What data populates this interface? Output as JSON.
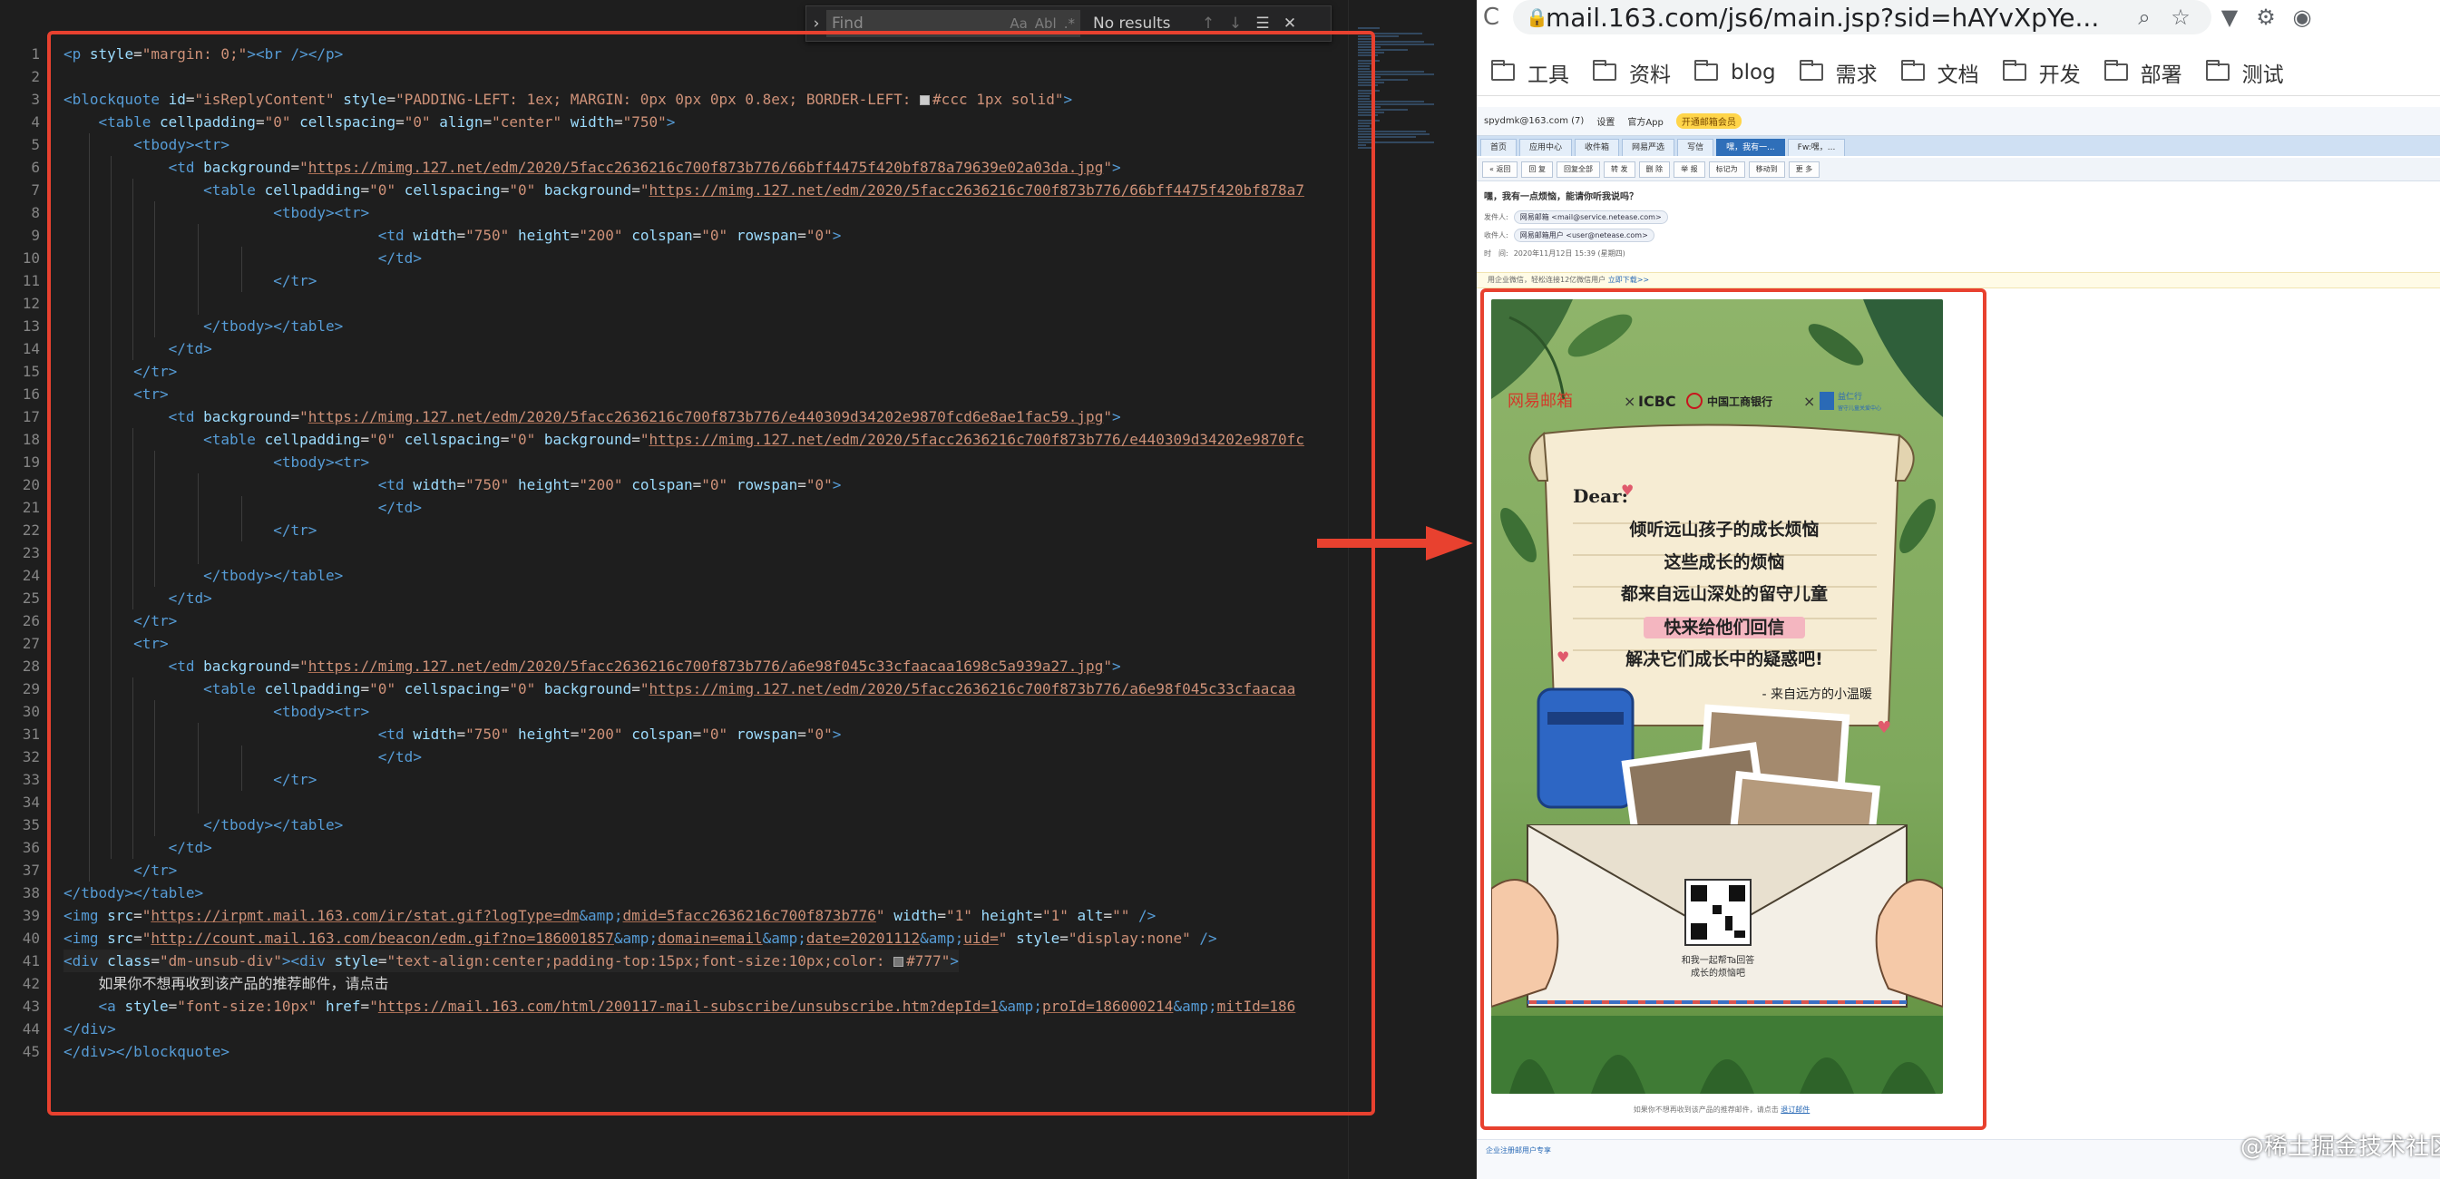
{
  "colors": {
    "accent_red": "#e8412f",
    "editor_bg": "#1e1e1e",
    "tag": "#569cd6",
    "attr": "#9cdcfe",
    "value": "#ce9178"
  },
  "find": {
    "placeholder": "Find",
    "opt_case": "Aa",
    "opt_word": "Abl",
    "opt_regex": ".*",
    "result": "No results",
    "icons": [
      "chevron-right-icon",
      "arrow-up-icon",
      "arrow-down-icon",
      "selection-icon",
      "close-icon"
    ]
  },
  "code": {
    "lines": [
      [
        [
          "tg",
          "<p "
        ],
        [
          "at",
          "style"
        ],
        [
          "eq",
          "="
        ],
        [
          "av",
          "\"margin: 0;\""
        ],
        [
          "tg",
          "><br /></p>"
        ]
      ],
      [],
      [
        [
          "tg",
          "<blockquote "
        ],
        [
          "at",
          "id"
        ],
        [
          "eq",
          "="
        ],
        [
          "av",
          "\"isReplyContent\""
        ],
        [
          "eq",
          " "
        ],
        [
          "at",
          "style"
        ],
        [
          "eq",
          "="
        ],
        [
          "av",
          "\"PADDING-LEFT: 1ex; MARGIN: 0px 0px 0px 0.8ex; BORDER-LEFT: "
        ],
        [
          "sw",
          "#ccc"
        ],
        [
          "av",
          "#ccc 1px solid\""
        ],
        [
          "tg",
          ">"
        ]
      ],
      [
        [
          "ws",
          "    "
        ],
        [
          "tg",
          "<table "
        ],
        [
          "at",
          "cellpadding"
        ],
        [
          "eq",
          "="
        ],
        [
          "av",
          "\"0\""
        ],
        [
          "eq",
          " "
        ],
        [
          "at",
          "cellspacing"
        ],
        [
          "eq",
          "="
        ],
        [
          "av",
          "\"0\""
        ],
        [
          "eq",
          " "
        ],
        [
          "at",
          "align"
        ],
        [
          "eq",
          "="
        ],
        [
          "av",
          "\"center\""
        ],
        [
          "eq",
          " "
        ],
        [
          "at",
          "width"
        ],
        [
          "eq",
          "="
        ],
        [
          "av",
          "\"750\""
        ],
        [
          "tg",
          ">"
        ]
      ],
      [
        [
          "ws",
          "        "
        ],
        [
          "tg",
          "<tbody><tr>"
        ]
      ],
      [
        [
          "ws",
          "            "
        ],
        [
          "tg",
          "<td "
        ],
        [
          "at",
          "background"
        ],
        [
          "eq",
          "="
        ],
        [
          "av",
          "\""
        ],
        [
          "ul",
          "https://mimg.127.net/edm/2020/5facc2636216c700f873b776/66bff4475f420bf878a79639e02a03da.jpg"
        ],
        [
          "av",
          "\""
        ],
        [
          "tg",
          ">"
        ]
      ],
      [
        [
          "ws",
          "                "
        ],
        [
          "tg",
          "<table "
        ],
        [
          "at",
          "cellpadding"
        ],
        [
          "eq",
          "="
        ],
        [
          "av",
          "\"0\""
        ],
        [
          "eq",
          " "
        ],
        [
          "at",
          "cellspacing"
        ],
        [
          "eq",
          "="
        ],
        [
          "av",
          "\"0\""
        ],
        [
          "eq",
          " "
        ],
        [
          "at",
          "background"
        ],
        [
          "eq",
          "="
        ],
        [
          "av",
          "\""
        ],
        [
          "ul",
          "https://mimg.127.net/edm/2020/5facc2636216c700f873b776/66bff4475f420bf878a7"
        ]
      ],
      [
        [
          "ws",
          "                        "
        ],
        [
          "tg",
          "<tbody><tr>"
        ]
      ],
      [
        [
          "ws",
          "                                    "
        ],
        [
          "tg",
          "<td "
        ],
        [
          "at",
          "width"
        ],
        [
          "eq",
          "="
        ],
        [
          "av",
          "\"750\""
        ],
        [
          "eq",
          " "
        ],
        [
          "at",
          "height"
        ],
        [
          "eq",
          "="
        ],
        [
          "av",
          "\"200\""
        ],
        [
          "eq",
          " "
        ],
        [
          "at",
          "colspan"
        ],
        [
          "eq",
          "="
        ],
        [
          "av",
          "\"0\""
        ],
        [
          "eq",
          " "
        ],
        [
          "at",
          "rowspan"
        ],
        [
          "eq",
          "="
        ],
        [
          "av",
          "\"0\""
        ],
        [
          "tg",
          ">"
        ]
      ],
      [
        [
          "ws",
          "                                    "
        ],
        [
          "tg",
          "</td>"
        ]
      ],
      [
        [
          "ws",
          "                        "
        ],
        [
          "tg",
          "</tr>"
        ]
      ],
      [],
      [
        [
          "ws",
          "                "
        ],
        [
          "tg",
          "</tbody></table>"
        ]
      ],
      [
        [
          "ws",
          "            "
        ],
        [
          "tg",
          "</td>"
        ]
      ],
      [
        [
          "ws",
          "        "
        ],
        [
          "tg",
          "</tr>"
        ]
      ],
      [
        [
          "ws",
          "        "
        ],
        [
          "tg",
          "<tr>"
        ]
      ],
      [
        [
          "ws",
          "            "
        ],
        [
          "tg",
          "<td "
        ],
        [
          "at",
          "background"
        ],
        [
          "eq",
          "="
        ],
        [
          "av",
          "\""
        ],
        [
          "ul",
          "https://mimg.127.net/edm/2020/5facc2636216c700f873b776/e440309d34202e9870fcd6e8ae1fac59.jpg"
        ],
        [
          "av",
          "\""
        ],
        [
          "tg",
          ">"
        ]
      ],
      [
        [
          "ws",
          "                "
        ],
        [
          "tg",
          "<table "
        ],
        [
          "at",
          "cellpadding"
        ],
        [
          "eq",
          "="
        ],
        [
          "av",
          "\"0\""
        ],
        [
          "eq",
          " "
        ],
        [
          "at",
          "cellspacing"
        ],
        [
          "eq",
          "="
        ],
        [
          "av",
          "\"0\""
        ],
        [
          "eq",
          " "
        ],
        [
          "at",
          "background"
        ],
        [
          "eq",
          "="
        ],
        [
          "av",
          "\""
        ],
        [
          "ul",
          "https://mimg.127.net/edm/2020/5facc2636216c700f873b776/e440309d34202e9870fc"
        ]
      ],
      [
        [
          "ws",
          "                        "
        ],
        [
          "tg",
          "<tbody><tr>"
        ]
      ],
      [
        [
          "ws",
          "                                    "
        ],
        [
          "tg",
          "<td "
        ],
        [
          "at",
          "width"
        ],
        [
          "eq",
          "="
        ],
        [
          "av",
          "\"750\""
        ],
        [
          "eq",
          " "
        ],
        [
          "at",
          "height"
        ],
        [
          "eq",
          "="
        ],
        [
          "av",
          "\"200\""
        ],
        [
          "eq",
          " "
        ],
        [
          "at",
          "colspan"
        ],
        [
          "eq",
          "="
        ],
        [
          "av",
          "\"0\""
        ],
        [
          "eq",
          " "
        ],
        [
          "at",
          "rowspan"
        ],
        [
          "eq",
          "="
        ],
        [
          "av",
          "\"0\""
        ],
        [
          "tg",
          ">"
        ]
      ],
      [
        [
          "ws",
          "                                    "
        ],
        [
          "tg",
          "</td>"
        ]
      ],
      [
        [
          "ws",
          "                        "
        ],
        [
          "tg",
          "</tr>"
        ]
      ],
      [],
      [
        [
          "ws",
          "                "
        ],
        [
          "tg",
          "</tbody></table>"
        ]
      ],
      [
        [
          "ws",
          "            "
        ],
        [
          "tg",
          "</td>"
        ]
      ],
      [
        [
          "ws",
          "        "
        ],
        [
          "tg",
          "</tr>"
        ]
      ],
      [
        [
          "ws",
          "        "
        ],
        [
          "tg",
          "<tr>"
        ]
      ],
      [
        [
          "ws",
          "            "
        ],
        [
          "tg",
          "<td "
        ],
        [
          "at",
          "background"
        ],
        [
          "eq",
          "="
        ],
        [
          "av",
          "\""
        ],
        [
          "ul",
          "https://mimg.127.net/edm/2020/5facc2636216c700f873b776/a6e98f045c33cfaacaa1698c5a939a27.jpg"
        ],
        [
          "av",
          "\""
        ],
        [
          "tg",
          ">"
        ]
      ],
      [
        [
          "ws",
          "                "
        ],
        [
          "tg",
          "<table "
        ],
        [
          "at",
          "cellpadding"
        ],
        [
          "eq",
          "="
        ],
        [
          "av",
          "\"0\""
        ],
        [
          "eq",
          " "
        ],
        [
          "at",
          "cellspacing"
        ],
        [
          "eq",
          "="
        ],
        [
          "av",
          "\"0\""
        ],
        [
          "eq",
          " "
        ],
        [
          "at",
          "background"
        ],
        [
          "eq",
          "="
        ],
        [
          "av",
          "\""
        ],
        [
          "ul",
          "https://mimg.127.net/edm/2020/5facc2636216c700f873b776/a6e98f045c33cfaacaa"
        ]
      ],
      [
        [
          "ws",
          "                        "
        ],
        [
          "tg",
          "<tbody><tr>"
        ]
      ],
      [
        [
          "ws",
          "                                    "
        ],
        [
          "tg",
          "<td "
        ],
        [
          "at",
          "width"
        ],
        [
          "eq",
          "="
        ],
        [
          "av",
          "\"750\""
        ],
        [
          "eq",
          " "
        ],
        [
          "at",
          "height"
        ],
        [
          "eq",
          "="
        ],
        [
          "av",
          "\"200\""
        ],
        [
          "eq",
          " "
        ],
        [
          "at",
          "colspan"
        ],
        [
          "eq",
          "="
        ],
        [
          "av",
          "\"0\""
        ],
        [
          "eq",
          " "
        ],
        [
          "at",
          "rowspan"
        ],
        [
          "eq",
          "="
        ],
        [
          "av",
          "\"0\""
        ],
        [
          "tg",
          ">"
        ]
      ],
      [
        [
          "ws",
          "                                    "
        ],
        [
          "tg",
          "</td>"
        ]
      ],
      [
        [
          "ws",
          "                        "
        ],
        [
          "tg",
          "</tr>"
        ]
      ],
      [],
      [
        [
          "ws",
          "                "
        ],
        [
          "tg",
          "</tbody></table>"
        ]
      ],
      [
        [
          "ws",
          "            "
        ],
        [
          "tg",
          "</td>"
        ]
      ],
      [
        [
          "ws",
          "        "
        ],
        [
          "tg",
          "</tr>"
        ]
      ],
      [
        [
          "tg",
          "</tbody></table>"
        ]
      ],
      [
        [
          "tg",
          "<img "
        ],
        [
          "at",
          "src"
        ],
        [
          "eq",
          "="
        ],
        [
          "av",
          "\""
        ],
        [
          "ul",
          "https://irpmt.mail.163.com/ir/stat.gif?logType=dm"
        ],
        [
          "ent",
          "&amp;"
        ],
        [
          "ul",
          "dmid=5facc2636216c700f873b776"
        ],
        [
          "av",
          "\""
        ],
        [
          "eq",
          " "
        ],
        [
          "at",
          "width"
        ],
        [
          "eq",
          "="
        ],
        [
          "av",
          "\"1\""
        ],
        [
          "eq",
          " "
        ],
        [
          "at",
          "height"
        ],
        [
          "eq",
          "="
        ],
        [
          "av",
          "\"1\""
        ],
        [
          "eq",
          " "
        ],
        [
          "at",
          "alt"
        ],
        [
          "eq",
          "="
        ],
        [
          "av",
          "\"\""
        ],
        [
          "tg",
          " />"
        ]
      ],
      [
        [
          "tg",
          "<img "
        ],
        [
          "at",
          "src"
        ],
        [
          "eq",
          "="
        ],
        [
          "av",
          "\""
        ],
        [
          "ul",
          "http://count.mail.163.com/beacon/edm.gif?no=186001857"
        ],
        [
          "ent",
          "&amp;"
        ],
        [
          "ul",
          "domain=email"
        ],
        [
          "ent",
          "&amp;"
        ],
        [
          "ul",
          "date=20201112"
        ],
        [
          "ent",
          "&amp;"
        ],
        [
          "ul",
          "uid="
        ],
        [
          "av",
          "\""
        ],
        [
          "eq",
          " "
        ],
        [
          "at",
          "style"
        ],
        [
          "eq",
          "="
        ],
        [
          "av",
          "\"display:none\""
        ],
        [
          "tg",
          " />"
        ]
      ],
      [
        [
          "tg",
          "<div "
        ],
        [
          "at",
          "class"
        ],
        [
          "eq",
          "="
        ],
        [
          "av",
          "\"dm-unsub-div\""
        ],
        [
          "tg",
          ">"
        ],
        [
          "tg",
          "<div "
        ],
        [
          "at",
          "style"
        ],
        [
          "eq",
          "="
        ],
        [
          "av",
          "\"text-align:center;padding-top:15px;font-size:10px;color: "
        ],
        [
          "sw",
          "#777"
        ],
        [
          "av",
          "#777\""
        ],
        [
          "tg",
          ">"
        ]
      ],
      [
        [
          "ws",
          "    "
        ],
        [
          "eq",
          "如果你不想再收到该产品的推荐邮件，请点击"
        ]
      ],
      [
        [
          "ws",
          "    "
        ],
        [
          "tg",
          "<a "
        ],
        [
          "at",
          "style"
        ],
        [
          "eq",
          "="
        ],
        [
          "av",
          "\"font-size:10px\""
        ],
        [
          "eq",
          " "
        ],
        [
          "at",
          "href"
        ],
        [
          "eq",
          "="
        ],
        [
          "av",
          "\""
        ],
        [
          "ul",
          "https://mail.163.com/html/200117-mail-subscribe/unsubscribe.htm?depId=1"
        ],
        [
          "ent",
          "&amp;"
        ],
        [
          "ul",
          "proId=186000214"
        ],
        [
          "ent",
          "&amp;"
        ],
        [
          "ul",
          "mitId=186"
        ]
      ],
      [
        [
          "tg",
          "</div>"
        ]
      ],
      [
        [
          "tg",
          "</div></blockquote>"
        ]
      ]
    ]
  },
  "browser": {
    "url": "mail.163.com/js6/main.jsp?sid=hAYvXpYe...",
    "url_icons": [
      "reload-icon",
      "lock-icon",
      "zoom-icon",
      "star-icon",
      "extension-icon",
      "settings-icon",
      "chrome-icon"
    ],
    "bookmarks": [
      "工具",
      "资料",
      "blog",
      "需求",
      "文档",
      "开发",
      "部署",
      "测试"
    ]
  },
  "mail": {
    "account": "spydmk@163.com (7)",
    "top_links": [
      "设置",
      "官方App"
    ],
    "top_pill": "开通邮箱会员",
    "tabs": [
      "首页",
      "应用中心",
      "收件箱",
      "网易严选",
      "写信",
      "嘿，我有一...",
      "Fw:嘿，..."
    ],
    "active_tab": 5,
    "toolbar": [
      "« 返回",
      "回 复",
      "回复全部",
      "转 发",
      "删 除",
      "举 报",
      "标记为",
      "移动到",
      "更 多"
    ],
    "subject": "嘿，我有一点烦恼，能请你听我说吗？",
    "from_label": "发件人:",
    "from_value": "网易邮箱 <mail@service.netease.com>",
    "to_label": "收件人:",
    "to_value": "网易邮箱用户 <user@netease.com>",
    "time_label": "时　间:",
    "time_value": "2020年11月12日 15:39 (星期四)",
    "notice": "用企业微信，轻松连接12亿微信用户",
    "notice_link": "立即下载>>",
    "unsub_text": "如果你不想再收到该产品的推荐邮件，请点击",
    "unsub_link": "退订邮件",
    "footer_link": "企业注册邮用户专享"
  },
  "poster": {
    "brand1": "网易邮箱",
    "x": "×",
    "brand2": "ICBC",
    "brand2_cn": "中国工商银行",
    "brand3": "益仁行",
    "brand3_sub": "留守儿童关爱中心",
    "dear": "Dear:",
    "lines": [
      "倾听远山孩子的成长烦恼",
      "这些成长的烦恼",
      "都来自远山深处的留守儿童",
      "快来给他们回信",
      "解决它们成长中的疑惑吧!"
    ],
    "sign": "- 来自远方的小温暖",
    "qr_caption1": "和我一起帮Ta回答",
    "qr_caption2": "成长的烦恼吧"
  },
  "watermark": "@稀土掘金技术社区"
}
